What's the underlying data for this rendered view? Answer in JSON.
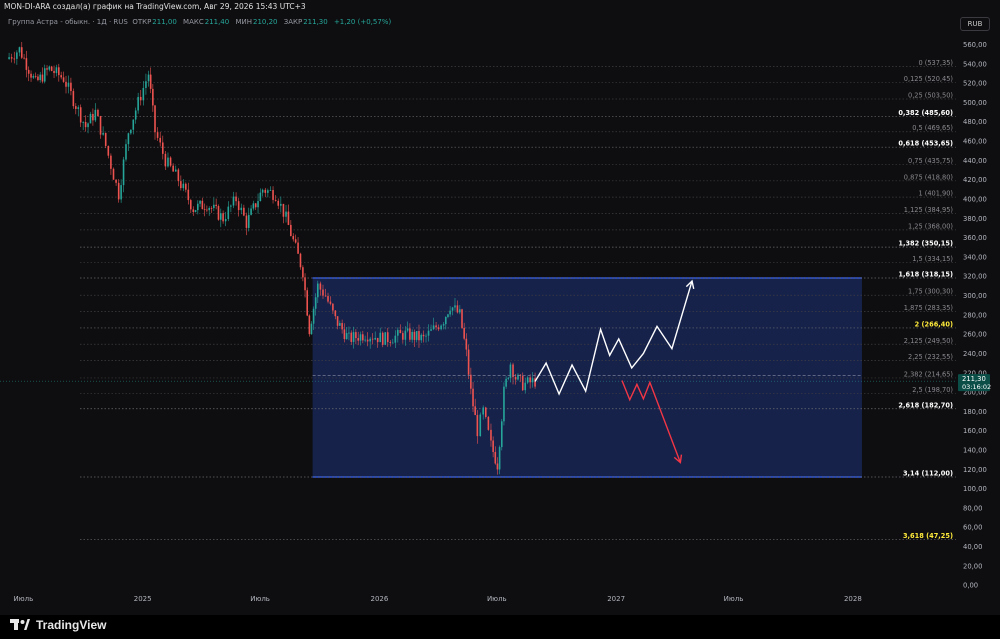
{
  "header": {
    "title": "MON-DI-ARA создал(а) график на TradingView.com, Авг 29, 2026 15:43 UTC+3"
  },
  "legend": {
    "symbol": "Группа Астра - обыкн.",
    "interval": "1Д",
    "exchange": "RUS",
    "open_label": "ОТКР",
    "open_value": "211,00",
    "high_label": "МАКС",
    "high_value": "211,40",
    "low_label": "МИН",
    "low_value": "210,20",
    "close_label": "ЗАКР",
    "close_value": "211,30",
    "change": "+1,20 (+0,57%)"
  },
  "currency": "RUB",
  "brand": {
    "name": "TradingView"
  },
  "colors": {
    "background": "#0e0e10",
    "up": "#26a69a",
    "down": "#ef5350",
    "box_fill": "#1a2a5e",
    "box_border": "#2f55d4",
    "fib_highlight": "#ffeb3b",
    "arrow_up": "#ffffff",
    "arrow_down": "#f23645",
    "last_price_bg": "#0b4d47"
  },
  "chart_data": {
    "type": "candlestick",
    "y_axis": {
      "range": [
        -5,
        575
      ],
      "ticks": [
        "0,00",
        "20,00",
        "40,00",
        "60,00",
        "80,00",
        "100,00",
        "120,00",
        "140,00",
        "160,00",
        "180,00",
        "200,00",
        "220,00",
        "240,00",
        "260,00",
        "280,00",
        "300,00",
        "320,00",
        "340,00",
        "360,00",
        "380,00",
        "400,00",
        "420,00",
        "440,00",
        "460,00",
        "480,00",
        "500,00",
        "520,00",
        "540,00",
        "560,00"
      ],
      "tick_values": [
        0,
        20,
        40,
        60,
        80,
        100,
        120,
        140,
        160,
        180,
        200,
        220,
        240,
        260,
        280,
        300,
        320,
        340,
        360,
        380,
        400,
        420,
        440,
        460,
        480,
        500,
        520,
        540,
        560
      ]
    },
    "x_axis": {
      "range": [
        "2024-05-26",
        "2028-06-08"
      ],
      "ticks": [
        {
          "label": "Июль",
          "date": "2024-07-01"
        },
        {
          "label": "2025",
          "date": "2025-01-01"
        },
        {
          "label": "Июль",
          "date": "2025-07-01"
        },
        {
          "label": "2026",
          "date": "2026-01-01"
        },
        {
          "label": "Июль",
          "date": "2026-07-01"
        },
        {
          "label": "2027",
          "date": "2027-01-01"
        },
        {
          "label": "Июль",
          "date": "2027-07-01"
        },
        {
          "label": "2028",
          "date": "2028-01-01"
        }
      ]
    },
    "price_path": [
      {
        "date": "2024-06-05",
        "price": 545
      },
      {
        "date": "2024-06-25",
        "price": 555
      },
      {
        "date": "2024-07-20",
        "price": 520
      },
      {
        "date": "2024-08-10",
        "price": 535
      },
      {
        "date": "2024-09-01",
        "price": 525
      },
      {
        "date": "2024-10-05",
        "price": 475
      },
      {
        "date": "2024-10-20",
        "price": 490
      },
      {
        "date": "2024-11-05",
        "price": 455
      },
      {
        "date": "2024-11-25",
        "price": 405
      },
      {
        "date": "2024-12-10",
        "price": 470
      },
      {
        "date": "2024-12-25",
        "price": 500
      },
      {
        "date": "2025-01-10",
        "price": 530
      },
      {
        "date": "2025-01-20",
        "price": 470
      },
      {
        "date": "2025-02-05",
        "price": 440
      },
      {
        "date": "2025-02-25",
        "price": 420
      },
      {
        "date": "2025-03-20",
        "price": 390
      },
      {
        "date": "2025-04-10",
        "price": 395
      },
      {
        "date": "2025-05-05",
        "price": 380
      },
      {
        "date": "2025-05-25",
        "price": 400
      },
      {
        "date": "2025-06-10",
        "price": 375
      },
      {
        "date": "2025-07-05",
        "price": 410
      },
      {
        "date": "2025-07-25",
        "price": 405
      },
      {
        "date": "2025-08-10",
        "price": 380
      },
      {
        "date": "2025-09-05",
        "price": 325
      },
      {
        "date": "2025-09-15",
        "price": 265
      },
      {
        "date": "2025-09-28",
        "price": 310
      },
      {
        "date": "2025-10-10",
        "price": 300
      },
      {
        "date": "2025-10-25",
        "price": 275
      },
      {
        "date": "2025-11-15",
        "price": 255
      },
      {
        "date": "2025-12-10",
        "price": 260
      },
      {
        "date": "2026-01-10",
        "price": 255
      },
      {
        "date": "2026-02-10",
        "price": 260
      },
      {
        "date": "2026-03-10",
        "price": 255
      },
      {
        "date": "2026-04-10",
        "price": 275
      },
      {
        "date": "2026-04-20",
        "price": 290
      },
      {
        "date": "2026-05-05",
        "price": 280
      },
      {
        "date": "2026-05-15",
        "price": 240
      },
      {
        "date": "2026-05-22",
        "price": 200
      },
      {
        "date": "2026-06-01",
        "price": 160
      },
      {
        "date": "2026-06-10",
        "price": 180
      },
      {
        "date": "2026-06-22",
        "price": 145
      },
      {
        "date": "2026-07-02",
        "price": 125
      },
      {
        "date": "2026-07-12",
        "price": 200
      },
      {
        "date": "2026-07-22",
        "price": 230
      },
      {
        "date": "2026-07-30",
        "price": 215
      },
      {
        "date": "2026-08-10",
        "price": 208
      },
      {
        "date": "2026-08-29",
        "price": 211.3
      }
    ],
    "last_price": {
      "value": "211,30",
      "countdown": "03:16:02"
    },
    "fib_levels": [
      {
        "ratio": "0",
        "price": 537.35,
        "label": "0 (537,35)",
        "highlight": false
      },
      {
        "ratio": "0,125",
        "price": 520.45,
        "label": "0,125 (520,45)",
        "highlight": false
      },
      {
        "ratio": "0,25",
        "price": 503.5,
        "label": "0,25 (503,50)",
        "highlight": false
      },
      {
        "ratio": "0,382",
        "price": 485.6,
        "label": "0,382 (485,60)",
        "highlight": true
      },
      {
        "ratio": "0,5",
        "price": 469.65,
        "label": "0,5 (469,65)",
        "highlight": false
      },
      {
        "ratio": "0,618",
        "price": 453.65,
        "label": "0,618 (453,65)",
        "highlight": true
      },
      {
        "ratio": "0,75",
        "price": 435.75,
        "label": "0,75 (435,75)",
        "highlight": false
      },
      {
        "ratio": "0,875",
        "price": 418.8,
        "label": "0,875 (418,80)",
        "highlight": false
      },
      {
        "ratio": "1",
        "price": 401.9,
        "label": "1 (401,90)",
        "highlight": false
      },
      {
        "ratio": "1,125",
        "price": 384.95,
        "label": "1,125 (384,95)",
        "highlight": false
      },
      {
        "ratio": "1,25",
        "price": 368.0,
        "label": "1,25 (368,00)",
        "highlight": false
      },
      {
        "ratio": "1,382",
        "price": 350.15,
        "label": "1,382 (350,15)",
        "highlight": true
      },
      {
        "ratio": "1,5",
        "price": 334.15,
        "label": "1,5 (334,15)",
        "highlight": false
      },
      {
        "ratio": "1,618",
        "price": 318.15,
        "label": "1,618 (318,15)",
        "highlight": true
      },
      {
        "ratio": "1,75",
        "price": 300.3,
        "label": "1,75 (300,30)",
        "highlight": false
      },
      {
        "ratio": "1,875",
        "price": 283.35,
        "label": "1,875 (283,35)",
        "highlight": false
      },
      {
        "ratio": "2",
        "price": 266.4,
        "label": "2 (266,40)",
        "highlight": "yellow"
      },
      {
        "ratio": "2,125",
        "price": 249.5,
        "label": "2,125 (249,50)",
        "highlight": false
      },
      {
        "ratio": "2,25",
        "price": 232.55,
        "label": "2,25 (232,55)",
        "highlight": false
      },
      {
        "ratio": "2,382",
        "price": 214.65,
        "label": "2,382 (214,65)",
        "highlight": false
      },
      {
        "ratio": "2,5",
        "price": 198.7,
        "label": "2,5 (198,70)",
        "highlight": false
      },
      {
        "ratio": "2,618",
        "price": 182.7,
        "label": "2,618 (182,70)",
        "highlight": true
      },
      {
        "ratio": "3,14",
        "price": 112.0,
        "label": "3,14 (112,00)",
        "highlight": true
      },
      {
        "ratio": "3,618",
        "price": 47.25,
        "label": "3,618 (47,25)",
        "highlight": "yellow"
      }
    ],
    "range_box": {
      "start": "2025-09-20",
      "end": "2028-01-15",
      "top": 318.15,
      "bottom": 112.0
    },
    "projection_up": [
      {
        "date": "2026-08-29",
        "price": 211
      },
      {
        "date": "2026-09-15",
        "price": 230
      },
      {
        "date": "2026-10-05",
        "price": 198
      },
      {
        "date": "2026-10-25",
        "price": 228
      },
      {
        "date": "2026-11-15",
        "price": 201
      },
      {
        "date": "2026-12-08",
        "price": 265
      },
      {
        "date": "2026-12-22",
        "price": 238
      },
      {
        "date": "2027-01-05",
        "price": 255
      },
      {
        "date": "2027-01-25",
        "price": 225
      },
      {
        "date": "2027-02-12",
        "price": 240
      },
      {
        "date": "2027-03-05",
        "price": 268
      },
      {
        "date": "2027-03-28",
        "price": 245
      },
      {
        "date": "2027-04-28",
        "price": 315
      }
    ],
    "projection_down": [
      {
        "date": "2027-01-10",
        "price": 212
      },
      {
        "date": "2027-01-22",
        "price": 192
      },
      {
        "date": "2027-02-02",
        "price": 208
      },
      {
        "date": "2027-02-12",
        "price": 193
      },
      {
        "date": "2027-02-22",
        "price": 210
      },
      {
        "date": "2027-04-10",
        "price": 127
      }
    ]
  }
}
